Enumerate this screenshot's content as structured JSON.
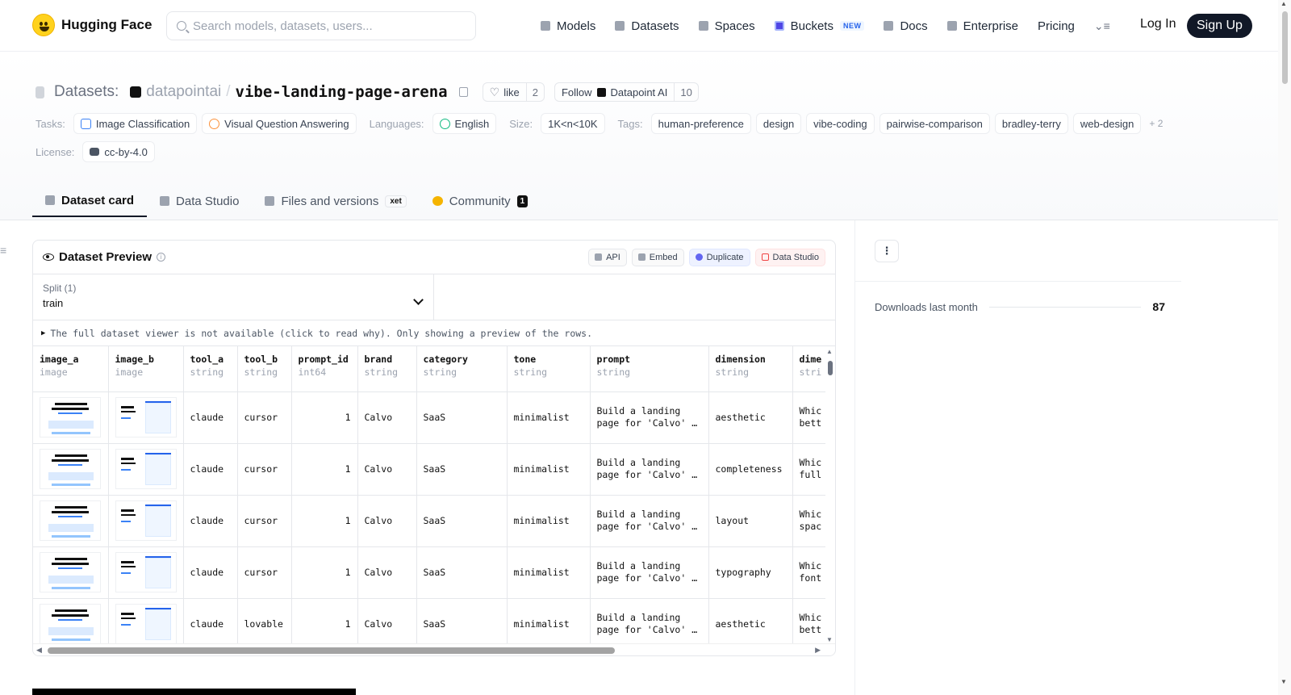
{
  "nav": {
    "brand": "Hugging Face",
    "search_placeholder": "Search models, datasets, users...",
    "links": [
      "Models",
      "Datasets",
      "Spaces",
      "Buckets",
      "Docs",
      "Enterprise",
      "Pricing"
    ],
    "buckets_badge": "NEW",
    "login": "Log In",
    "signup": "Sign Up"
  },
  "repo": {
    "type_label": "Datasets:",
    "org": "datapointai",
    "name": "vibe-landing-page-arena",
    "like_label": "like",
    "like_count": "2",
    "follow_label": "Follow",
    "follow_org": "Datapoint AI",
    "follow_count": "10"
  },
  "meta": {
    "tasks_label": "Tasks:",
    "tasks": [
      "Image Classification",
      "Visual Question Answering"
    ],
    "languages_label": "Languages:",
    "language": "English",
    "size_label": "Size:",
    "size": "1K<n<10K",
    "tags_label": "Tags:",
    "tags": [
      "human-preference",
      "design",
      "vibe-coding",
      "pairwise-comparison",
      "bradley-terry",
      "web-design"
    ],
    "tags_more": "+ 2",
    "license_label": "License:",
    "license": "cc-by-4.0"
  },
  "tabs": {
    "card": "Dataset card",
    "studio": "Data Studio",
    "files": "Files and versions",
    "xet": "xet",
    "community": "Community",
    "community_count": "1"
  },
  "preview": {
    "title": "Dataset Preview",
    "actions": [
      "API",
      "Embed",
      "Duplicate",
      "Data Studio"
    ],
    "split_label": "Split (1)",
    "split_value": "train",
    "notice": "The full dataset viewer is not available (click to read why). Only showing a preview of the rows.",
    "columns": [
      {
        "name": "image_a",
        "type": "image"
      },
      {
        "name": "image_b",
        "type": "image"
      },
      {
        "name": "tool_a",
        "type": "string"
      },
      {
        "name": "tool_b",
        "type": "string"
      },
      {
        "name": "prompt_id",
        "type": "int64"
      },
      {
        "name": "brand",
        "type": "string"
      },
      {
        "name": "category",
        "type": "string"
      },
      {
        "name": "tone",
        "type": "string"
      },
      {
        "name": "prompt",
        "type": "string"
      },
      {
        "name": "dimension",
        "type": "string"
      },
      {
        "name": "dime",
        "type": "stri"
      }
    ],
    "rows": [
      {
        "tool_a": "claude",
        "tool_b": "cursor",
        "prompt_id": "1",
        "brand": "Calvo",
        "category": "SaaS",
        "tone": "minimalist",
        "prompt": "Build a landing page for 'Calvo' …",
        "dimension": "aesthetic",
        "q": "Whic bett"
      },
      {
        "tool_a": "claude",
        "tool_b": "cursor",
        "prompt_id": "1",
        "brand": "Calvo",
        "category": "SaaS",
        "tone": "minimalist",
        "prompt": "Build a landing page for 'Calvo' …",
        "dimension": "completeness",
        "q": "Whic full"
      },
      {
        "tool_a": "claude",
        "tool_b": "cursor",
        "prompt_id": "1",
        "brand": "Calvo",
        "category": "SaaS",
        "tone": "minimalist",
        "prompt": "Build a landing page for 'Calvo' …",
        "dimension": "layout",
        "q": "Whic spac"
      },
      {
        "tool_a": "claude",
        "tool_b": "cursor",
        "prompt_id": "1",
        "brand": "Calvo",
        "category": "SaaS",
        "tone": "minimalist",
        "prompt": "Build a landing page for 'Calvo' …",
        "dimension": "typography",
        "q": "Whic font"
      },
      {
        "tool_a": "claude",
        "tool_b": "lovable",
        "prompt_id": "1",
        "brand": "Calvo",
        "category": "SaaS",
        "tone": "minimalist",
        "prompt": "Build a landing page for 'Calvo' …",
        "dimension": "aesthetic",
        "q": "Whic bett"
      }
    ]
  },
  "sidebar": {
    "downloads_label": "Downloads last month",
    "downloads_value": "87"
  }
}
